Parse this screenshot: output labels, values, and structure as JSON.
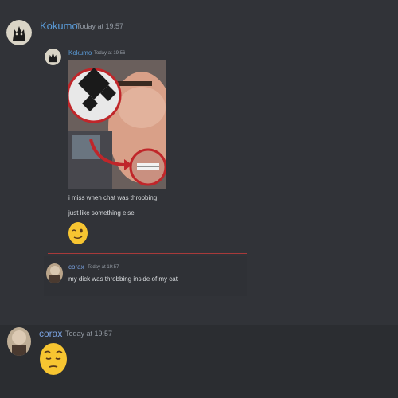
{
  "main_message": {
    "username": "Kokumo",
    "timestamp": "Today at 19:57"
  },
  "nested_message": {
    "username": "Kokumo",
    "timestamp": "Today at 19:56",
    "lines": [
      "i miss when chat was throbbing",
      "just like something else"
    ],
    "reaction_emoji": "winking-face"
  },
  "reply_message": {
    "username": "corax",
    "timestamp": "Today at 19:57",
    "text": "my dick was throbbing inside of my cat"
  },
  "last_message": {
    "username": "corax",
    "timestamp": "Today at 19:57",
    "emoji": "pensive-face"
  },
  "colors": {
    "background": "#313338",
    "username_kokumo": "#5a9bd8",
    "username_corax": "#7aa2e0",
    "divider": "#a83a3a"
  }
}
